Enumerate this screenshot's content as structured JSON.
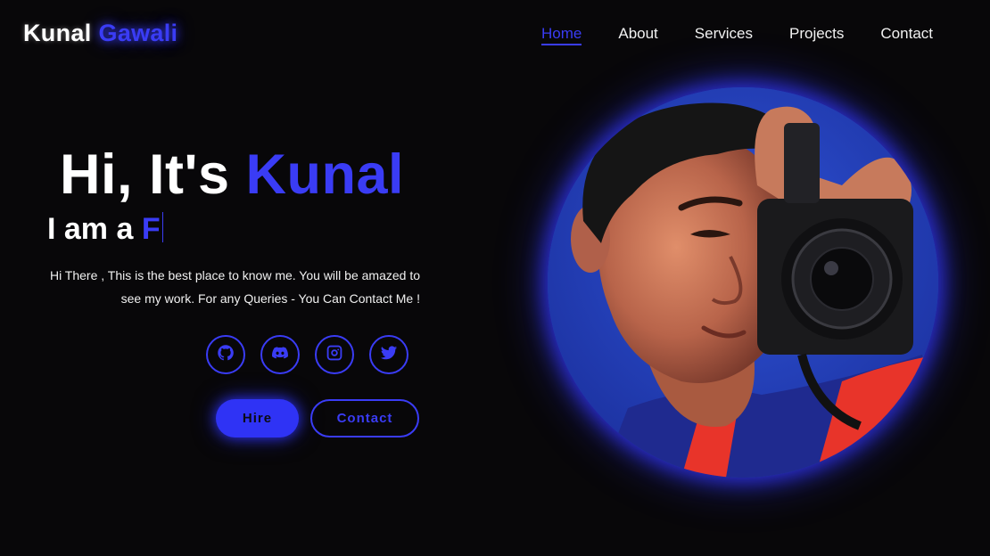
{
  "brand": {
    "first": "Kunal",
    "last": "Gawali"
  },
  "nav": {
    "items": [
      {
        "label": "Home",
        "active": true
      },
      {
        "label": "About",
        "active": false
      },
      {
        "label": "Services",
        "active": false
      },
      {
        "label": "Projects",
        "active": false
      },
      {
        "label": "Contact",
        "active": false
      }
    ]
  },
  "hero": {
    "greeting": "Hi, It's",
    "name": "Kunal",
    "role_prefix": "I am a",
    "role_typed": "F",
    "description": "Hi There , This is the best place to know me. You will be amazed to see my work. For any Queries - You Can Contact Me !"
  },
  "socials": [
    {
      "icon": "github-icon"
    },
    {
      "icon": "discord-icon"
    },
    {
      "icon": "instagram-icon"
    },
    {
      "icon": "twitter-icon"
    }
  ],
  "buttons": {
    "hire": "Hire",
    "contact": "Contact"
  },
  "colors": {
    "accent": "#3a3cf5",
    "background": "#080709",
    "text": "#ffffff"
  }
}
